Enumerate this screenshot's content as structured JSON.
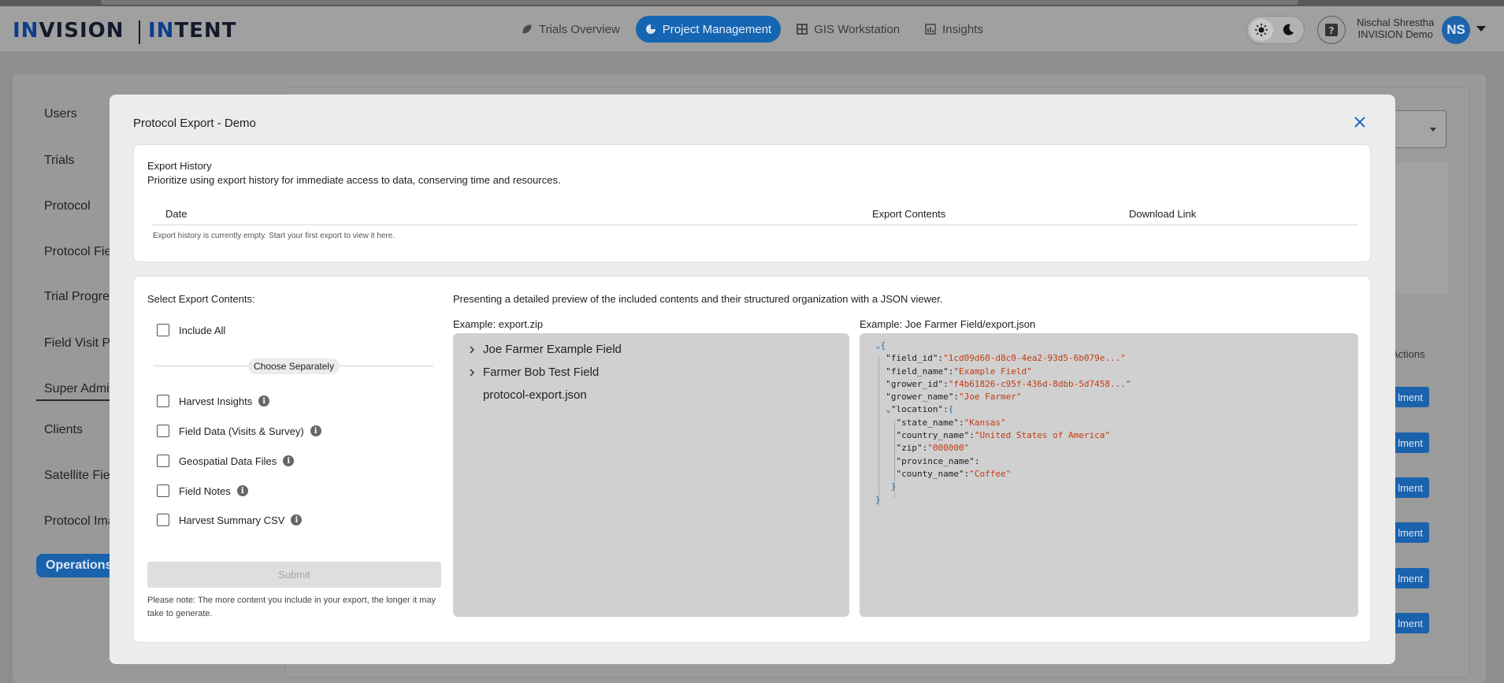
{
  "header": {
    "logo_left_accent": "IN",
    "logo_left_rest": "VISION",
    "logo_right_accent": "IN",
    "logo_right_rest": "TENT",
    "nav": [
      {
        "label": "Trials Overview",
        "icon": "leaf-icon"
      },
      {
        "label": "Project Management",
        "icon": "pie-chart-icon",
        "active": true
      },
      {
        "label": "GIS Workstation",
        "icon": "grid-icon"
      },
      {
        "label": "Insights",
        "icon": "bar-chart-icon"
      }
    ],
    "user_name": "Nischal Shrestha",
    "user_org": "INVISION Demo",
    "avatar_initials": "NS",
    "accent_color": "#1565b3"
  },
  "sidebar": {
    "items": [
      "Users",
      "Trials",
      "Protocol",
      "Protocol Fie",
      "Trial Progres",
      "Field Visit Pla",
      "Super Admin",
      "Clients",
      "Satellite Fiel",
      "Protocol Ima",
      "Operations S"
    ]
  },
  "background": {
    "actions_label": "Actions",
    "row_button_label": "lment"
  },
  "modal": {
    "title": "Protocol Export - Demo",
    "history": {
      "title": "Export History",
      "subtitle": "Prioritize using export history for immediate access to data, conserving time and resources.",
      "columns": [
        "Date",
        "Export Contents",
        "Download Link"
      ],
      "empty_text": "Export history is currently empty. Start your first export to view it here."
    },
    "export": {
      "select_title": "Select Export Contents:",
      "include_all": "Include All",
      "choose_separately": "Choose Separately",
      "options": [
        "Harvest Insights",
        "Field Data (Visits & Survey)",
        "Geospatial Data Files",
        "Field Notes",
        "Harvest Summary CSV"
      ],
      "submit_label": "Submit",
      "note": "Please note: The more content you include in your export, the longer it may take to generate.",
      "preview_title": "Presenting a detailed preview of the included contents and their structured organization with a JSON viewer.",
      "zip_label": "Example: export.zip",
      "json_label": "Example: Joe Farmer Field/export.json",
      "tree": [
        "Joe Farmer Example Field",
        "Farmer Bob Test Field",
        "protocol-export.json"
      ],
      "json": {
        "open_brace": "{",
        "field_id_key": "\"field_id\"",
        "field_id_val": "\"1cd09d60-d8c0-4ea2-93d5-6b079e...\"",
        "field_name_key": "\"field_name\"",
        "field_name_val": "\"Example Field\"",
        "grower_id_key": "\"grower_id\"",
        "grower_id_val": "\"f4b61826-c95f-436d-8dbb-5d7458...\"",
        "grower_name_key": "\"grower_name\"",
        "grower_name_val": "\"Joe Farmer\"",
        "location_key": "\"location\"",
        "state_name_key": "\"state_name\"",
        "state_name_val": "\"Kansas\"",
        "country_name_key": "\"country_name\"",
        "country_name_val": "\"United States of America\"",
        "zip_key": "\"zip\"",
        "zip_val": "\"000000\"",
        "province_name_key": "\"province_name\"",
        "county_name_key": "\"county_name\"",
        "county_name_val": "\"Coffee\"",
        "close_brace": "}"
      }
    }
  }
}
